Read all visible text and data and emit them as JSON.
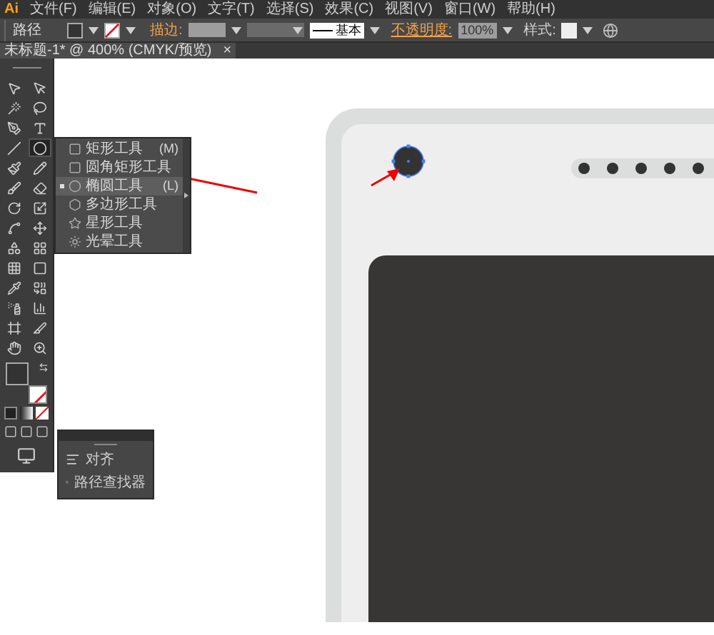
{
  "app": {
    "logo": "Ai"
  },
  "menu": [
    "文件(F)",
    "编辑(E)",
    "对象(O)",
    "文字(T)",
    "选择(S)",
    "效果(C)",
    "视图(V)",
    "窗口(W)",
    "帮助(H)"
  ],
  "control_bar": {
    "object_type": "路径",
    "stroke_label": "描边:",
    "stroke_profile": "基本",
    "opacity_label": "不透明度:",
    "opacity": "100%",
    "style_label": "样式:"
  },
  "document_tab": {
    "title": "未标题-1* @ 400% (CMYK/预览)",
    "close": "×"
  },
  "tools": [
    {
      "kind": "selection",
      "selected": false
    },
    {
      "kind": "direct-selection",
      "selected": false
    },
    {
      "kind": "magic-wand",
      "selected": false
    },
    {
      "kind": "lasso",
      "selected": false
    },
    {
      "kind": "pen",
      "selected": false
    },
    {
      "kind": "type",
      "selected": false
    },
    {
      "kind": "line",
      "selected": false
    },
    {
      "kind": "ellipse",
      "selected": true
    },
    {
      "kind": "paintbrush",
      "selected": false
    },
    {
      "kind": "pencil",
      "selected": false
    },
    {
      "kind": "blob-brush",
      "selected": false
    },
    {
      "kind": "eraser",
      "selected": false
    },
    {
      "kind": "rotate",
      "selected": false
    },
    {
      "kind": "scale",
      "selected": false
    },
    {
      "kind": "warp",
      "selected": false
    },
    {
      "kind": "free-transform",
      "selected": false
    },
    {
      "kind": "shape-builder",
      "selected": false
    },
    {
      "kind": "perspective-grid",
      "selected": false
    },
    {
      "kind": "mesh",
      "selected": false
    },
    {
      "kind": "gradient",
      "selected": false
    },
    {
      "kind": "eyedropper",
      "selected": false
    },
    {
      "kind": "blend",
      "selected": false
    },
    {
      "kind": "symbol-sprayer",
      "selected": false
    },
    {
      "kind": "column-graph",
      "selected": false
    },
    {
      "kind": "artboard",
      "selected": false
    },
    {
      "kind": "slice",
      "selected": false
    },
    {
      "kind": "hand",
      "selected": false
    },
    {
      "kind": "zoom",
      "selected": false
    }
  ],
  "shape_flyout": [
    {
      "kind": "rectangle",
      "label": "矩形工具",
      "shortcut": "(M)",
      "selected": false
    },
    {
      "kind": "rounded-rectangle",
      "label": "圆角矩形工具",
      "selected": false
    },
    {
      "kind": "ellipse",
      "label": "椭圆工具",
      "shortcut": "(L)",
      "selected": true
    },
    {
      "kind": "polygon",
      "label": "多边形工具",
      "selected": false
    },
    {
      "kind": "star",
      "label": "星形工具",
      "selected": false
    },
    {
      "kind": "flare",
      "label": "光晕工具",
      "selected": false
    }
  ],
  "panel": [
    {
      "kind": "align",
      "label": "对齐"
    },
    {
      "kind": "pathfinder",
      "label": "路径查找器"
    }
  ]
}
